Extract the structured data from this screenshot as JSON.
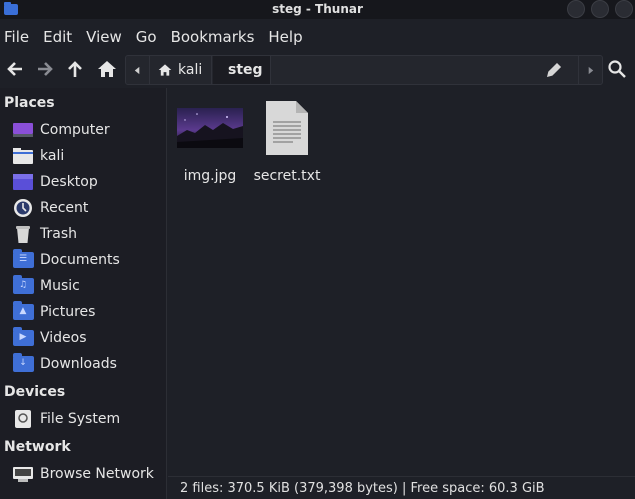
{
  "window": {
    "title": "steg - Thunar"
  },
  "menu": [
    "File",
    "Edit",
    "View",
    "Go",
    "Bookmarks",
    "Help"
  ],
  "pathbar": {
    "crumbs": [
      "kali",
      "steg"
    ]
  },
  "sidebar": {
    "places_label": "Places",
    "places": [
      {
        "label": "Computer",
        "icon": "computer-icon"
      },
      {
        "label": "kali",
        "icon": "home-folder-icon"
      },
      {
        "label": "Desktop",
        "icon": "desktop-folder-icon"
      },
      {
        "label": "Recent",
        "icon": "recent-icon"
      },
      {
        "label": "Trash",
        "icon": "trash-icon"
      },
      {
        "label": "Documents",
        "icon": "documents-folder-icon"
      },
      {
        "label": "Music",
        "icon": "music-folder-icon"
      },
      {
        "label": "Pictures",
        "icon": "pictures-folder-icon"
      },
      {
        "label": "Videos",
        "icon": "videos-folder-icon"
      },
      {
        "label": "Downloads",
        "icon": "downloads-folder-icon"
      }
    ],
    "devices_label": "Devices",
    "devices": [
      {
        "label": "File System",
        "icon": "drive-icon"
      }
    ],
    "network_label": "Network",
    "network": [
      {
        "label": "Browse Network",
        "icon": "network-icon"
      }
    ]
  },
  "files": [
    {
      "name": "img.jpg",
      "icon": "image-thumbnail"
    },
    {
      "name": "secret.txt",
      "icon": "text-file-icon"
    }
  ],
  "status": {
    "text": "2 files: 370.5 KiB (379,398 bytes)  |  Free space: 60.3 GiB"
  },
  "colors": {
    "accent": "#3f6fd6",
    "background": "#1e2027",
    "sidebar": "#1c1d24"
  }
}
